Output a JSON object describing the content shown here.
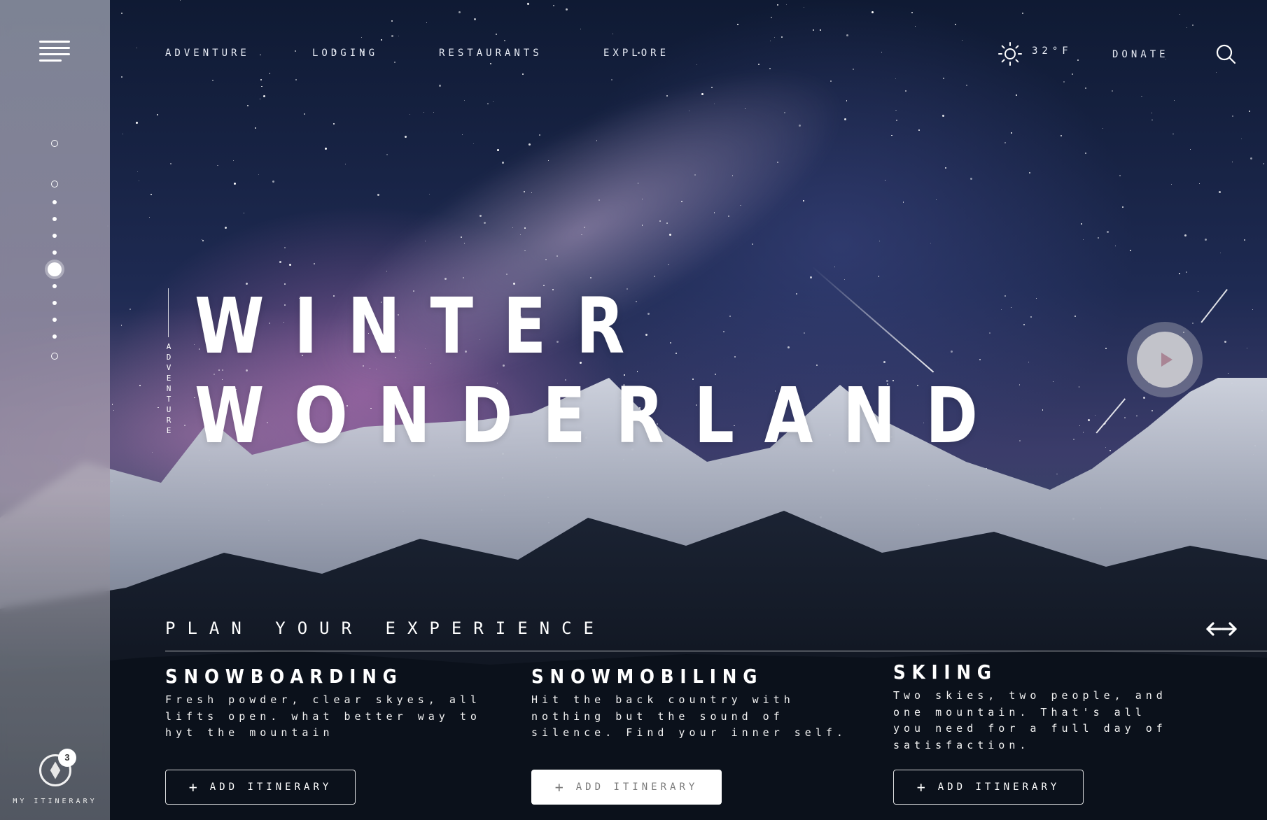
{
  "nav": {
    "items": [
      "ADVENTURE",
      "LODGING",
      "RESTAURANTS",
      "EXPLORE"
    ],
    "temperature": "32°F",
    "donate": "DONATE"
  },
  "sidebar": {
    "itinerary_count": "3",
    "itinerary_label": "MY ITINERARY",
    "active_step": 6,
    "step_count": 13
  },
  "hero": {
    "category": "ADVENTURE",
    "title_line1": "WINTER",
    "title_line2": "WONDERLAND"
  },
  "plan": {
    "title": "PLAN YOUR EXPERIENCE",
    "cards": [
      {
        "title": "SNOWBOARDING",
        "lines": [
          "Fresh powder, clear skyes, all",
          "lifts open. what better  way to",
          "hyt the mountain"
        ],
        "button": "ADD ITINERARY"
      },
      {
        "title": "SNOWMOBILING",
        "lines": [
          "Hit the back country with",
          "nothing but the sound of",
          "silence. Find your inner self."
        ],
        "button": "ADD ITINERARY"
      },
      {
        "title": "SKIING",
        "lines": [
          "Two skies, two people, and",
          "one mountain. That's all",
          "you need for a full day of",
          "satisfaction."
        ],
        "button": "ADD ITINERARY"
      }
    ]
  },
  "colors": {
    "accent": "#ffffff",
    "play_icon": "#a98595",
    "sky_top": "#0f1a33",
    "glow": "#c476be"
  }
}
